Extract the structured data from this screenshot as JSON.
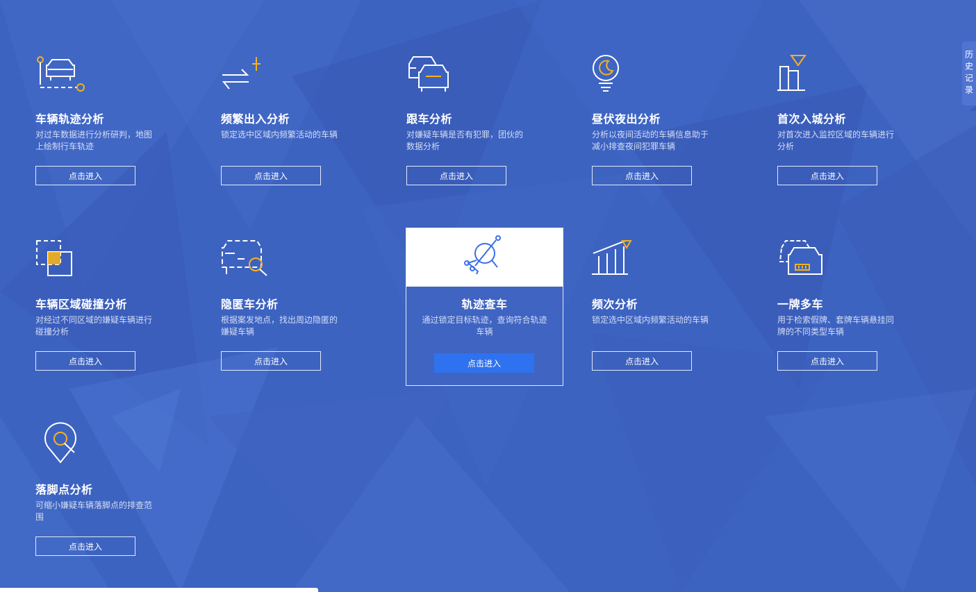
{
  "colors": {
    "background": "#3d63c1",
    "accent": "#f5b21b",
    "active_button": "#2f72f0",
    "line": "#ffffff"
  },
  "side_tab": {
    "label": "历史记录"
  },
  "cards": [
    {
      "title": "车辆轨迹分析",
      "desc": "对过车数据进行分析研判，地图上绘制行车轨迹",
      "button": "点击进入",
      "icon": "vehicle-track-icon"
    },
    {
      "title": "频繁出入分析",
      "desc": "锁定选中区域内频繁活动的车辆",
      "button": "点击进入",
      "icon": "frequent-in-out-icon"
    },
    {
      "title": "跟车分析",
      "desc": "对嫌疑车辆是否有犯罪，团伙的数据分析",
      "button": "点击进入",
      "icon": "follow-car-icon"
    },
    {
      "title": "昼伏夜出分析",
      "desc": "分析以夜间活动的车辆信息助于减小排查夜间犯罪车辆",
      "button": "点击进入",
      "icon": "night-moon-icon"
    },
    {
      "title": "首次入城分析",
      "desc": "对首次进入监控区域的车辆进行分析",
      "button": "点击进入",
      "icon": "first-entry-city-icon"
    },
    {
      "title": "车辆区域碰撞分析",
      "desc": "对经过不同区域的嫌疑车辆进行碰撞分析",
      "button": "点击进入",
      "icon": "area-collision-icon"
    },
    {
      "title": "隐匿车分析",
      "desc": "根据案发地点，找出周边隐匿的嫌疑车辆",
      "button": "点击进入",
      "icon": "hidden-car-search-icon"
    },
    {
      "title": "轨迹查车",
      "desc": "通过锁定目标轨迹，查询符合轨迹车辆",
      "button": "点击进入",
      "icon": "track-search-icon"
    },
    {
      "title": "频次分析",
      "desc": "锁定选中区域内频繁活动的车辆",
      "button": "点击进入",
      "icon": "frequency-chart-icon"
    },
    {
      "title": "一牌多车",
      "desc": "用于检索假牌、套牌车辆悬挂同牌的不同类型车辆",
      "button": "点击进入",
      "icon": "one-plate-multi-car-icon"
    },
    {
      "title": "落脚点分析",
      "desc": "可缩小嫌疑车辆落脚点的排查范围",
      "button": "点击进入",
      "icon": "foothold-location-icon"
    }
  ]
}
